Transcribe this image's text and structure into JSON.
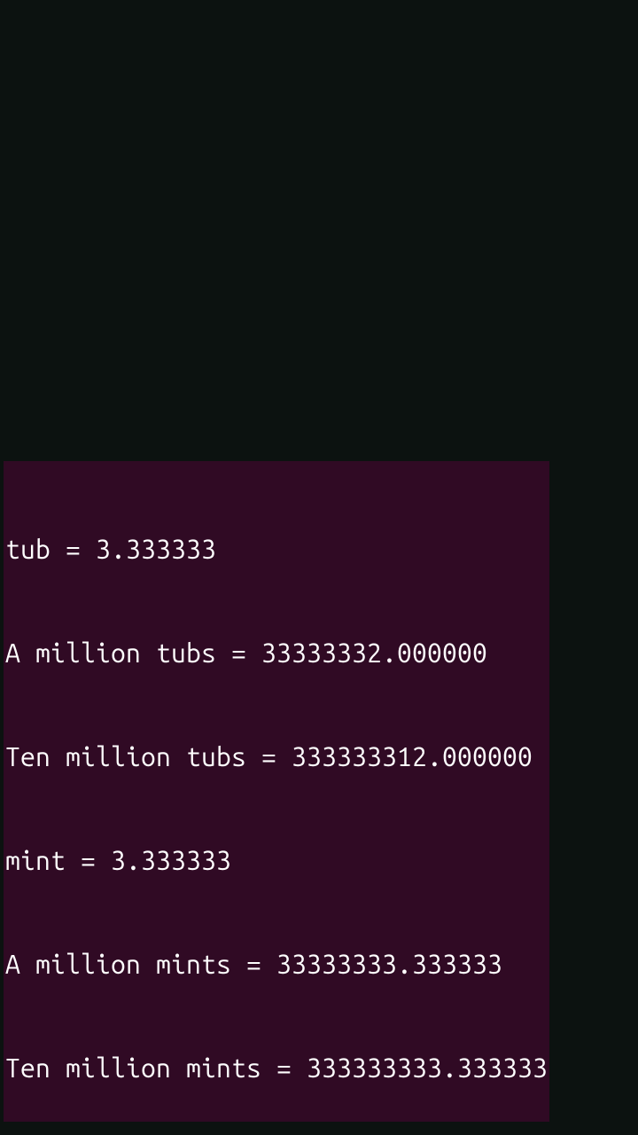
{
  "terminal": {
    "lines": [
      "tub = 3.333333",
      "A million tubs = 33333332.000000",
      "Ten million tubs = 333333312.000000",
      "mint = 3.333333",
      "A million mints = 33333333.333333",
      "Ten million mints = 333333333.333333"
    ]
  },
  "colors": {
    "background_outer": "#0c1210",
    "background_terminal": "#300a24",
    "text": "#ffffff"
  }
}
